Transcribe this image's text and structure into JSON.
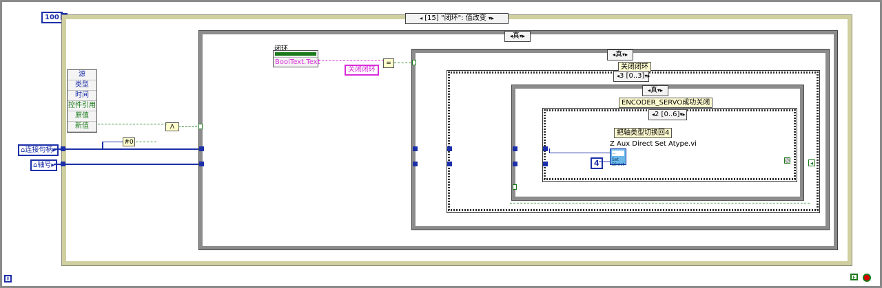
{
  "loop_count_label": "100",
  "event_case_selector": "[15] \"闭环\": 值改变",
  "case_outer_selector": "真",
  "case_inner_selector": "真",
  "case_inner2_selector": "真",
  "sequence_frame_selector": "3 [0..3]",
  "sequence_inner_selector": "2 [0..6]",
  "label_close_loop": "关闭闭环",
  "label_encoder": "ENCODER_SERVO成功关闭",
  "label_switch_axis": "把轴类型切换回4",
  "subvi_name": "Z Aux Direct Set Atype.vi",
  "subvi_top_text": "...",
  "subvi_bottom_text": "Set Direct",
  "const_four": "4",
  "boolean_control_label": "闭环",
  "property_node_row": "BoolText.Text",
  "string_constant": "关闭闭环",
  "compare_symbol": "=",
  "and_symbol": "Λ",
  "not_equal_symbol": "#0",
  "event_data": {
    "items": [
      "源",
      "类型",
      "时间",
      "控件引用",
      "原值",
      "新值"
    ]
  },
  "terminals": {
    "connection_handle": "连接句柄",
    "axis_number": "轴号"
  },
  "stop_label": "F",
  "iteration_label": "i",
  "colors": {
    "wire_blue": "#1b2fa8",
    "wire_green": "#2a8a2a",
    "string_pink": "#d92cd9",
    "stop_red": "#d00000"
  }
}
